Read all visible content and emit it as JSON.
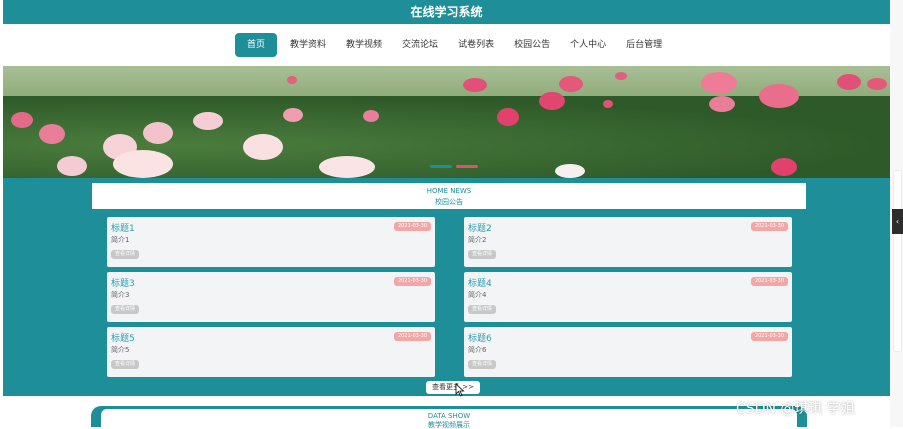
{
  "app": {
    "title": "在线学习系统"
  },
  "nav": {
    "items": [
      {
        "label": "首页",
        "active": true
      },
      {
        "label": "教学资料"
      },
      {
        "label": "教学视频"
      },
      {
        "label": "交流论坛"
      },
      {
        "label": "试卷列表"
      },
      {
        "label": "校园公告"
      },
      {
        "label": "个人中心"
      },
      {
        "label": "后台管理"
      }
    ]
  },
  "news": {
    "heading_en": "HOME NEWS",
    "heading_cn": "校园公告",
    "cards": [
      {
        "title": "标题1",
        "desc": "简介1",
        "date": "2021-03-30",
        "more": "查看详情"
      },
      {
        "title": "标题2",
        "desc": "简介2",
        "date": "2021-03-30",
        "more": "查看详情"
      },
      {
        "title": "标题3",
        "desc": "简介3",
        "date": "2021-03-30",
        "more": "查看详情"
      },
      {
        "title": "标题4",
        "desc": "简介4",
        "date": "2021-03-30",
        "more": "查看详情"
      },
      {
        "title": "标题5",
        "desc": "简介5",
        "date": "2021-03-30",
        "more": "查看详情"
      },
      {
        "title": "标题6",
        "desc": "简介6",
        "date": "2021-03-30",
        "more": "查看详情"
      }
    ],
    "more_button": "查看更多 >>"
  },
  "data_show": {
    "heading_en": "DATA SHOW",
    "heading_cn": "教学视频展示"
  },
  "watermark": "CSDN @琪琪 学姐",
  "colors": {
    "accent": "#1e8f98",
    "date_badge": "#f2a7a7",
    "title": "#2b9fb0"
  },
  "icons": {
    "side_tab": "chevron-left-icon",
    "cursor": "mouse-pointer-icon"
  }
}
